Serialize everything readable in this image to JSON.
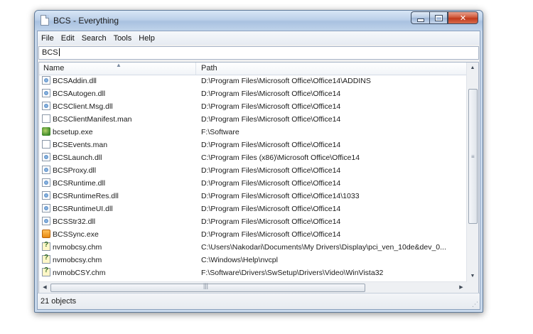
{
  "window": {
    "title": "BCS - Everything"
  },
  "menu": [
    "File",
    "Edit",
    "Search",
    "Tools",
    "Help"
  ],
  "search": {
    "value": "BCS"
  },
  "columns": {
    "name": "Name",
    "path": "Path"
  },
  "rows": [
    {
      "name": "BCSAddin.dll",
      "path": "D:\\Program Files\\Microsoft Office\\Office14\\ADDINS",
      "icon": "dll-file-icon"
    },
    {
      "name": "BCSAutogen.dll",
      "path": "D:\\Program Files\\Microsoft Office\\Office14",
      "icon": "dll-file-icon"
    },
    {
      "name": "BCSClient.Msg.dll",
      "path": "D:\\Program Files\\Microsoft Office\\Office14",
      "icon": "dll-file-icon"
    },
    {
      "name": "BCSClientManifest.man",
      "path": "D:\\Program Files\\Microsoft Office\\Office14",
      "icon": "document-file-icon"
    },
    {
      "name": "bcsetup.exe",
      "path": "F:\\Software",
      "icon": "setup-exe-icon"
    },
    {
      "name": "BCSEvents.man",
      "path": "D:\\Program Files\\Microsoft Office\\Office14",
      "icon": "document-file-icon"
    },
    {
      "name": "BCSLaunch.dll",
      "path": "C:\\Program Files (x86)\\Microsoft Office\\Office14",
      "icon": "dll-file-icon"
    },
    {
      "name": "BCSProxy.dll",
      "path": "D:\\Program Files\\Microsoft Office\\Office14",
      "icon": "dll-file-icon"
    },
    {
      "name": "BCSRuntime.dll",
      "path": "D:\\Program Files\\Microsoft Office\\Office14",
      "icon": "dll-file-icon"
    },
    {
      "name": "BCSRuntimeRes.dll",
      "path": "D:\\Program Files\\Microsoft Office\\Office14\\1033",
      "icon": "dll-file-icon"
    },
    {
      "name": "BCSRuntimeUI.dll",
      "path": "D:\\Program Files\\Microsoft Office\\Office14",
      "icon": "dll-file-icon"
    },
    {
      "name": "BCSStr32.dll",
      "path": "D:\\Program Files\\Microsoft Office\\Office14",
      "icon": "dll-file-icon"
    },
    {
      "name": "BCSSync.exe",
      "path": "D:\\Program Files\\Microsoft Office\\Office14",
      "icon": "office-exe-icon"
    },
    {
      "name": "nvmobcsy.chm",
      "path": "C:\\Users\\Nakodari\\Documents\\My Drivers\\Display\\pci_ven_10de&dev_0...",
      "icon": "help-file-icon"
    },
    {
      "name": "nvmobcsy.chm",
      "path": "C:\\Windows\\Help\\nvcpl",
      "icon": "help-file-icon"
    },
    {
      "name": "nvmobCSY.chm",
      "path": "F:\\Software\\Drivers\\SwSetup\\Drivers\\Video\\WinVista32",
      "icon": "help-file-icon"
    }
  ],
  "status": {
    "text": "21 objects"
  }
}
